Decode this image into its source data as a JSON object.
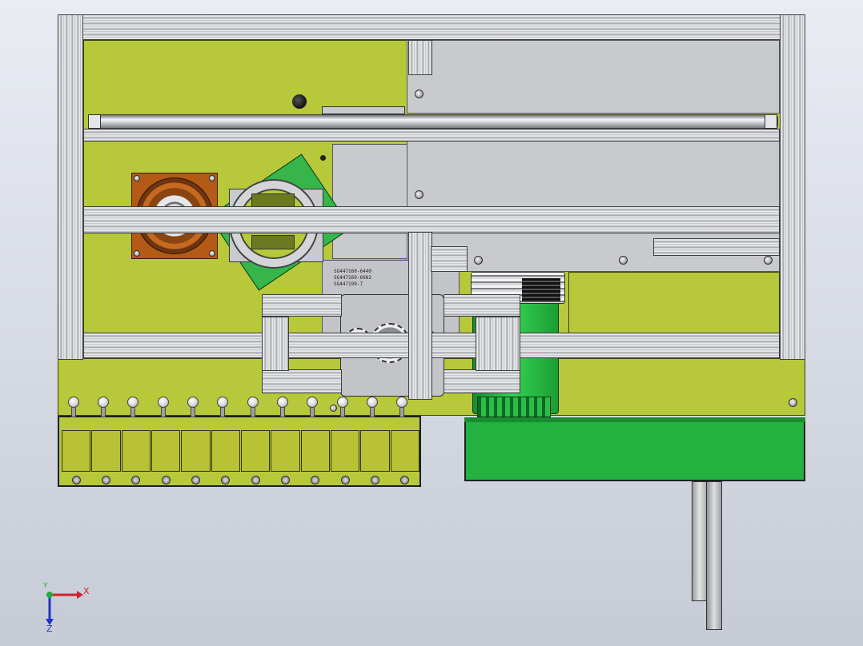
{
  "part_labels": {
    "line1": "SG447160-6440",
    "line2": "SG447160-6082",
    "line3": "SG447199-7"
  },
  "triad": {
    "x_label": "X",
    "y_label": "Y",
    "z_label": "Z",
    "x_color": "#d4202a",
    "y_color": "#28a83c",
    "z_color": "#2033c4"
  },
  "colors": {
    "base_plate": "#b7c83a",
    "cover_plate": "#c9cacd",
    "motor": "#23b140",
    "bearing": "#b35a16"
  },
  "feeder": {
    "slot_count": 12
  }
}
